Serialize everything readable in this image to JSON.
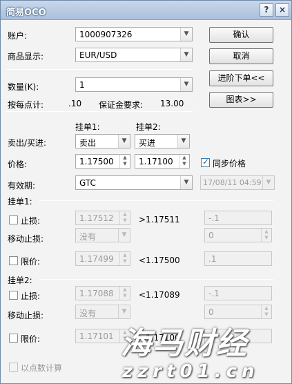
{
  "window": {
    "title": "简易OCO",
    "help_label": "?",
    "close_label": "×"
  },
  "account": {
    "label": "账户:",
    "value": "1000907326"
  },
  "product": {
    "label": "商品显示:",
    "value": "EUR/USD"
  },
  "buttons": {
    "confirm": "确认",
    "cancel": "取消",
    "advanced": "进阶下单<<",
    "chart": "图表>>"
  },
  "quantity": {
    "label": "数量(K):",
    "value": "1"
  },
  "per_point": {
    "label": "按每点计:",
    "value": ".10"
  },
  "margin": {
    "label": "保证金要求:",
    "value": "13.00"
  },
  "orders": {
    "order1_header": "挂单1:",
    "order2_header": "挂单2:"
  },
  "sell_buy": {
    "label": "卖出/买进:",
    "order1": "卖出",
    "order2": "买进"
  },
  "price": {
    "label": "价格:",
    "order1": "1.17500",
    "order2": "1.17100"
  },
  "sync_price": {
    "label": "同步价格",
    "checked": true
  },
  "validity": {
    "label": "有效期:",
    "value": "GTC",
    "datetime": "17/08/11 04:59"
  },
  "order1": {
    "header": "挂单1:",
    "stop_loss": {
      "label": "止损:",
      "value": "1.17512",
      "condition": ">1.17511",
      "pips": "-.1"
    },
    "trailing": {
      "label": "移动止损:",
      "value": "没有",
      "pips": "0"
    },
    "limit": {
      "label": "限价:",
      "value": "1.17499",
      "condition": "<1.17500",
      "pips": ".1"
    }
  },
  "order2": {
    "header": "挂单2:",
    "stop_loss": {
      "label": "止损:",
      "value": "1.17088",
      "condition": "<1.17089",
      "pips": "-.1"
    },
    "trailing": {
      "label": "移动止损:",
      "value": "没有",
      "pips": "0"
    },
    "limit": {
      "label": "限价:",
      "value": "1.17101",
      "condition": ">1.17100",
      "pips": ".1"
    }
  },
  "point_calc": {
    "label": "以点数计算"
  },
  "watermark": {
    "brand": "海马财经",
    "url": "zzrt01.cn"
  }
}
